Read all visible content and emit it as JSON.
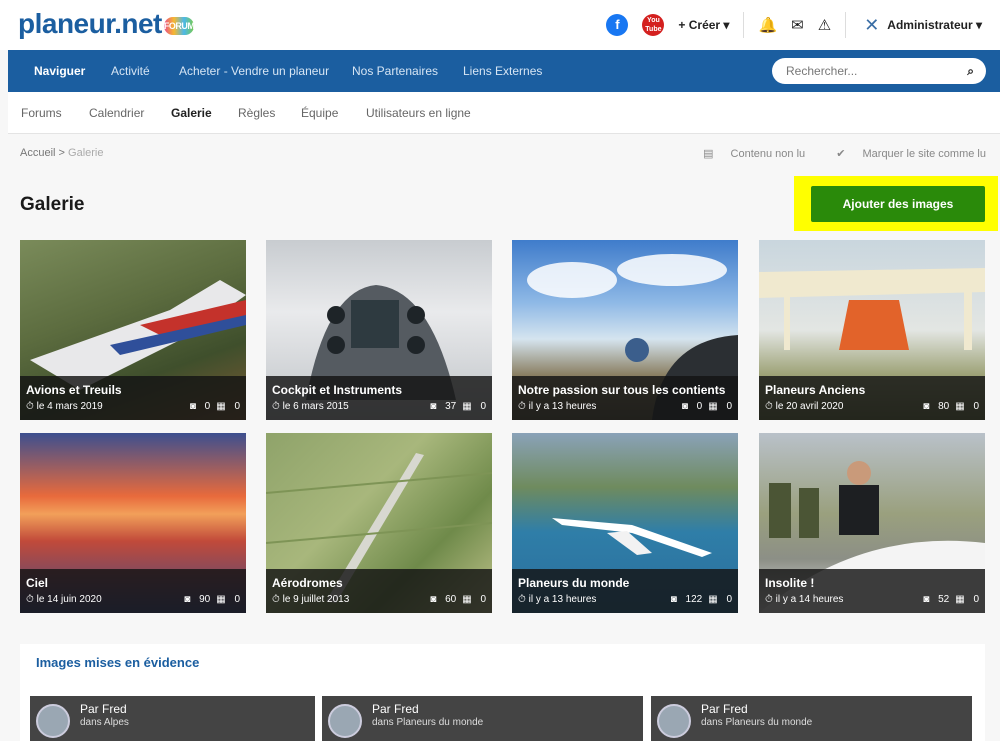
{
  "logo": {
    "text": "planeur.net",
    "badge": "FORUM"
  },
  "top_actions": {
    "facebook_label": "f",
    "youtube_label": "You Tube",
    "create_label": "+ Créer ▾",
    "user_label": "Administrateur ▾",
    "icons": [
      "bell-icon",
      "envelope-icon",
      "warning-icon",
      "tools-icon"
    ]
  },
  "nav": {
    "items": [
      "Naviguer",
      "Activité",
      "Acheter - Vendre un planeur",
      "Nos Partenaires",
      "Liens Externes"
    ],
    "search_placeholder": "Rechercher..."
  },
  "tabs": [
    "Forums",
    "Calendrier",
    "Galerie",
    "Règles",
    "Équipe",
    "Utilisateurs en ligne"
  ],
  "breadcrumb": {
    "home": "Accueil",
    "sep": ">",
    "current": "Galerie"
  },
  "page_actions": {
    "unread": "Contenu non lu",
    "mark_read": "Marquer le site comme lu"
  },
  "page_title": "Galerie",
  "add_images_label": "Ajouter des images",
  "albums": [
    {
      "name": "Avions et Treuils",
      "date": "le 4 mars 2019",
      "images": "0",
      "comments": "0"
    },
    {
      "name": "Cockpit et Instruments",
      "date": "le 6 mars 2015",
      "images": "37",
      "comments": "0"
    },
    {
      "name": "Notre passion sur tous les contients",
      "date": "il y a 13 heures",
      "images": "0",
      "comments": "0"
    },
    {
      "name": "Planeurs Anciens",
      "date": "le 20 avril 2020",
      "images": "80",
      "comments": "0"
    },
    {
      "name": "Ciel",
      "date": "le 14 juin 2020",
      "images": "90",
      "comments": "0"
    },
    {
      "name": "Aérodromes",
      "date": "le 9 juillet 2013",
      "images": "60",
      "comments": "0"
    },
    {
      "name": "Planeurs du monde",
      "date": "il y a 13 heures",
      "images": "122",
      "comments": "0"
    },
    {
      "name": "Insolite !",
      "date": "il y a 14 heures",
      "images": "52",
      "comments": "0"
    }
  ],
  "featured": {
    "title": "Images mises en évidence",
    "items": [
      {
        "by": "Par Fred",
        "in": "dans Alpes"
      },
      {
        "by": "Par Fred",
        "in": "dans Planeurs du monde"
      },
      {
        "by": "Par Fred",
        "in": "dans Planeurs du monde"
      }
    ]
  },
  "colors": {
    "brand_blue": "#1b5ea0",
    "add_button_green": "#2a8a0a",
    "highlight_yellow": "#ffff00"
  }
}
